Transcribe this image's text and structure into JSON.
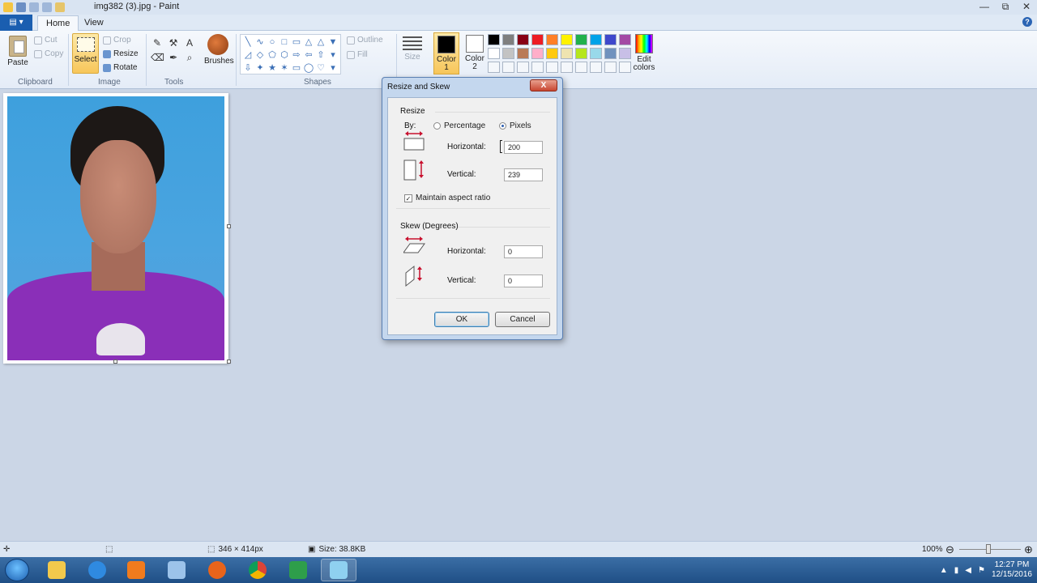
{
  "window": {
    "title": "img382 (3).jpg - Paint",
    "minimize": "—",
    "maximize": "⧉",
    "close": "✕"
  },
  "tabs": {
    "file": "▤ ▾",
    "home": "Home",
    "view": "View",
    "help": "?"
  },
  "ribbon": {
    "clipboard": {
      "paste": "Paste",
      "cut": "Cut",
      "copy": "Copy",
      "label": "Clipboard"
    },
    "image": {
      "select": "Select",
      "crop": "Crop",
      "resize": "Resize",
      "rotate": "Rotate",
      "label": "Image"
    },
    "tools": {
      "label": "Tools",
      "items": [
        "✎",
        "⚒",
        "A",
        "⌫",
        "✒",
        "⌕"
      ]
    },
    "brushes": "Brushes",
    "shapes": {
      "label": "Shapes",
      "outline": "Outline",
      "fill": "Fill",
      "items": [
        "╲",
        "∿",
        "○",
        "□",
        "▭",
        "△",
        "△",
        "▼",
        "◿",
        "◇",
        "⬠",
        "⬡",
        "⇨",
        "⇦",
        "⇧",
        "▾",
        "⇩",
        "✦",
        "★",
        "✶",
        "▭",
        "◯",
        "♡",
        "▾"
      ]
    },
    "size": "Size",
    "color1": {
      "line1": "Color",
      "line2": "1",
      "value": "#000000"
    },
    "color2": {
      "line1": "Color",
      "line2": "2",
      "value": "#ffffff"
    },
    "palette": [
      "#000000",
      "#7f7f7f",
      "#880015",
      "#ed1c24",
      "#ff7f27",
      "#fff200",
      "#22b14c",
      "#00a2e8",
      "#3f48cc",
      "#a349a4",
      "#ffffff",
      "#c3c3c3",
      "#b97a57",
      "#ffaec9",
      "#ffc90e",
      "#efe4b0",
      "#b5e61d",
      "#99d9ea",
      "#7092be",
      "#c8bfe7",
      "#f4f7fb",
      "#f4f7fb",
      "#f4f7fb",
      "#f4f7fb",
      "#f4f7fb",
      "#f4f7fb",
      "#f4f7fb",
      "#f4f7fb",
      "#f4f7fb",
      "#f4f7fb"
    ],
    "edit_colors": {
      "line1": "Edit",
      "line2": "colors"
    }
  },
  "dialog": {
    "title": "Resize and Skew",
    "close": "X",
    "resize_section": "Resize",
    "by_label": "By:",
    "percentage": "Percentage",
    "pixels": "Pixels",
    "horizontal_label": "Horizontal:",
    "horizontal_value": "200",
    "vertical_label": "Vertical:",
    "vertical_value": "239",
    "maintain_aspect": "Maintain aspect ratio",
    "skew_section": "Skew (Degrees)",
    "skew_horizontal_label": "Horizontal:",
    "skew_horizontal_value": "0",
    "skew_vertical_label": "Vertical:",
    "skew_vertical_value": "0",
    "ok": "OK",
    "cancel": "Cancel"
  },
  "statusbar": {
    "image_size": "346 × 414px",
    "file_size": "Size: 38.8KB",
    "zoom": "100%",
    "zoom_out": "⊖",
    "zoom_in": "⊕"
  },
  "taskbar": {
    "clock_time": "12:27 PM",
    "clock_date": "12/15/2016"
  }
}
